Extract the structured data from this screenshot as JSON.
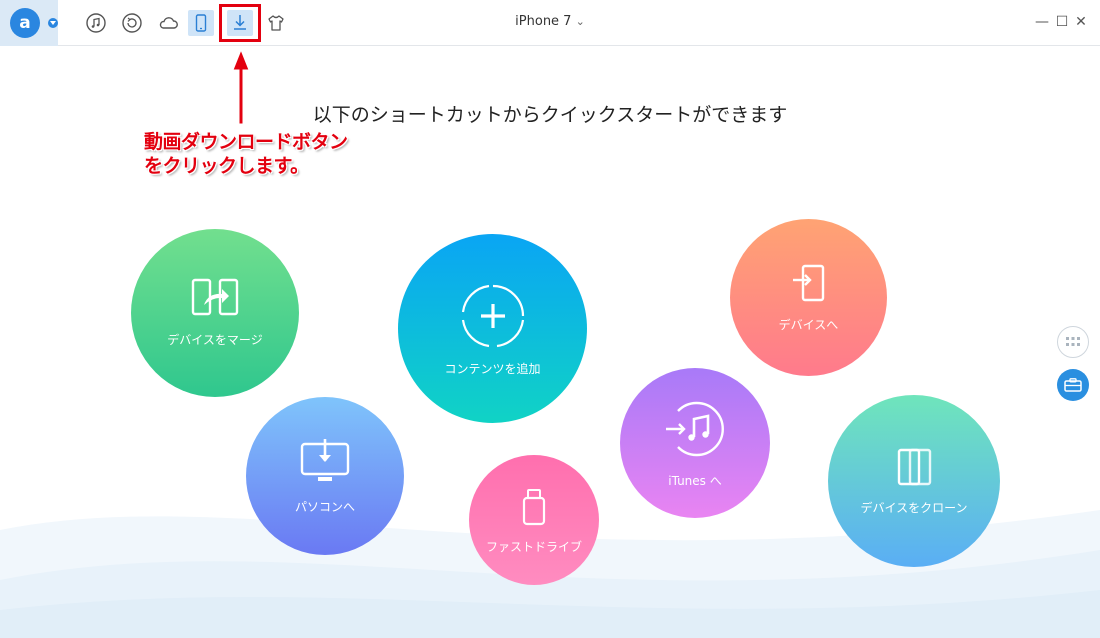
{
  "app": {
    "logo_letter": "a"
  },
  "toolbar": {
    "icons": [
      "music-icon",
      "restore-icon",
      "cloud-icon",
      "phone-icon",
      "download-icon",
      "tshirt-icon"
    ],
    "active_icon": "phone-icon",
    "highlighted_icon": "download-icon"
  },
  "device": {
    "name": "iPhone 7",
    "chevron": "⌄"
  },
  "window": {
    "minimize": "—",
    "maximize": "☐",
    "close": "✕"
  },
  "annotation": {
    "line1": "動画ダウンロードボタン",
    "line2": "をクリックします。",
    "color": "#e3000f"
  },
  "main": {
    "headline": "以下のショートカットからクイックスタートができます",
    "shortcuts": [
      {
        "label": "デバイスをマージ",
        "icon": "merge-devices-icon"
      },
      {
        "label": "コンテンツを追加",
        "icon": "add-content-icon"
      },
      {
        "label": "デバイスへ",
        "icon": "to-device-icon"
      },
      {
        "label": "パソコンへ",
        "icon": "to-computer-icon"
      },
      {
        "label": "ファストドライブ",
        "icon": "flash-drive-icon"
      },
      {
        "label": "iTunes へ",
        "icon": "to-itunes-icon"
      },
      {
        "label": "デバイスをクローン",
        "icon": "clone-device-icon"
      }
    ]
  },
  "side": {
    "icons": [
      "grid-icon",
      "toolbox-icon"
    ]
  }
}
